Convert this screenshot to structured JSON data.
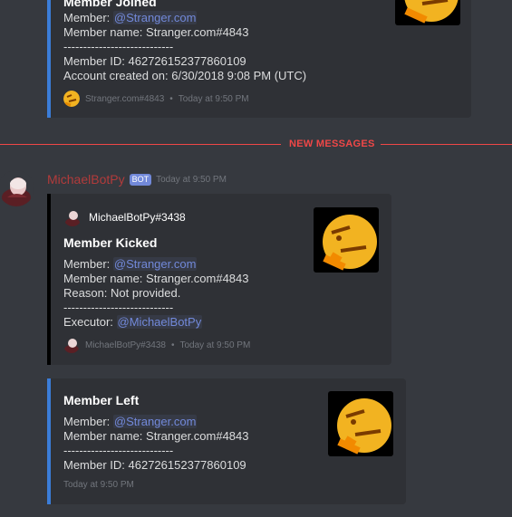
{
  "colors": {
    "background": "#36393f",
    "embed_bg": "#2f3136",
    "embed_blue": "#3b7dd8",
    "embed_black": "#000000",
    "mention": "#7289da",
    "new_messages": "#f04747",
    "bot_tag": "#7289da",
    "author_red": "#b23b3b"
  },
  "top_embed": {
    "title": "Member Joined",
    "member_label": "Member: ",
    "member_mention": "@Stranger.com",
    "member_name": "Member name: Stranger.com#4843",
    "separator": "----------------------------",
    "member_id": "Member ID: 462726152377860109",
    "account_created": "Account created on: 6/30/2018 9:08 PM (UTC)",
    "footer_name": "Stranger.com#4843",
    "footer_time": "Today at 9:50 PM"
  },
  "divider": {
    "label": "NEW MESSAGES"
  },
  "message": {
    "author": "MichaelBotPy",
    "bot_tag": "BOT",
    "timestamp": "Today at 9:50 PM"
  },
  "embed_kicked": {
    "author": "MichaelBotPy#3438",
    "title": "Member Kicked",
    "member_label": "Member: ",
    "member_mention": "@Stranger.com",
    "member_name": "Member name: Stranger.com#4843",
    "reason": "Reason: Not provided.",
    "separator": "----------------------------",
    "executor_label": "Executor: ",
    "executor_mention": "@MichaelBotPy",
    "footer_name": "MichaelBotPy#3438",
    "footer_time": "Today at 9:50 PM"
  },
  "embed_left": {
    "title": "Member Left",
    "member_label": "Member: ",
    "member_mention": "@Stranger.com",
    "member_name": "Member name: Stranger.com#4843",
    "separator": "----------------------------",
    "member_id": "Member ID: 462726152377860109",
    "footer_time": "Today at 9:50 PM"
  }
}
